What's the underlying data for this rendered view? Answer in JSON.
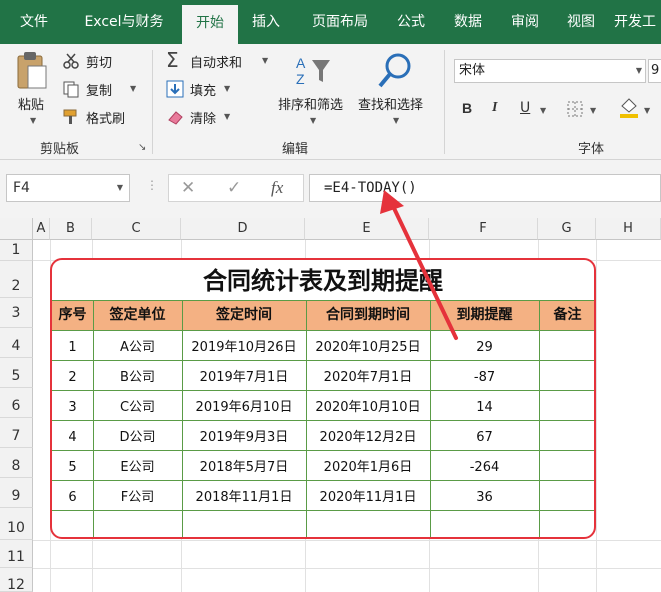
{
  "ribbon": {
    "tabs": [
      "文件",
      "Excel与财务",
      "开始",
      "插入",
      "页面布局",
      "公式",
      "数据",
      "审阅",
      "视图",
      "开发工"
    ],
    "active_tab": "开始",
    "clipboard": {
      "paste": "粘贴",
      "cut": "剪切",
      "copy": "复制",
      "format_painter": "格式刷",
      "group_label": "剪贴板"
    },
    "editing": {
      "autosum": "自动求和",
      "fill": "填充",
      "clear": "清除",
      "sort_filter": "排序和筛选",
      "find_select": "查找和选择",
      "group_label": "编辑"
    },
    "font": {
      "font_name": "宋体",
      "font_size": "9",
      "bold": "B",
      "italic": "I",
      "underline": "U",
      "group_label": "字体"
    }
  },
  "formula_bar": {
    "name_box": "F4",
    "cancel": "✕",
    "enter": "✓",
    "fx": "fx",
    "formula": "=E4-TODAY()"
  },
  "sheet": {
    "columns": [
      "A",
      "B",
      "C",
      "D",
      "E",
      "F",
      "G",
      "H"
    ],
    "rows": [
      "1",
      "2",
      "3",
      "4",
      "5",
      "6",
      "7",
      "8",
      "9",
      "10",
      "11",
      "12"
    ],
    "table": {
      "title": "合同统计表及到期提醒",
      "headers": [
        "序号",
        "签定单位",
        "签定时间",
        "合同到期时间",
        "到期提醒",
        "备注"
      ],
      "rows": [
        [
          "1",
          "A公司",
          "2019年10月26日",
          "2020年10月25日",
          "29",
          ""
        ],
        [
          "2",
          "B公司",
          "2019年7月1日",
          "2020年7月1日",
          "-87",
          ""
        ],
        [
          "3",
          "C公司",
          "2019年6月10日",
          "2020年10月10日",
          "14",
          ""
        ],
        [
          "4",
          "D公司",
          "2019年9月3日",
          "2020年12月2日",
          "67",
          ""
        ],
        [
          "5",
          "E公司",
          "2018年5月7日",
          "2020年1月6日",
          "-264",
          ""
        ],
        [
          "6",
          "F公司",
          "2018年11月1日",
          "2020年11月1日",
          "36",
          ""
        ],
        [
          "",
          "",
          "",
          "",
          "",
          ""
        ]
      ]
    }
  },
  "colors": {
    "ribbon_green": "#217346",
    "header_fill": "#f4b183",
    "frame_red": "#e5323b",
    "grid_green": "#5a9b46",
    "arrow_red": "#e5323b"
  }
}
